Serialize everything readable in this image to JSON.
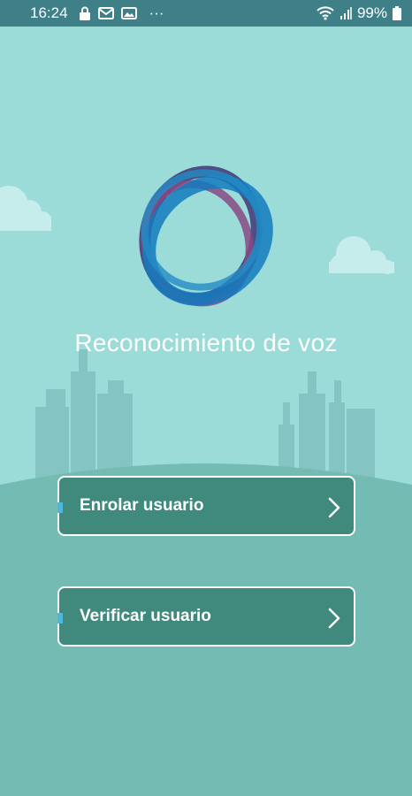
{
  "status_bar": {
    "time": "16:24",
    "notifications": [
      "lock-icon",
      "mail-icon",
      "gallery-icon"
    ],
    "overflow": "···",
    "battery": "99%",
    "icons": [
      "wifi-icon",
      "signal-icon",
      "battery-icon"
    ]
  },
  "app": {
    "title": "Reconocimiento de voz",
    "logo": "voice-recognition-logo"
  },
  "menu": {
    "enrol_label": "Enrolar usuario",
    "verify_label": "Verificar usuario"
  },
  "colors": {
    "background": "#9bdcd9",
    "status_bar": "#3f7f87",
    "button": "#3f8a7d",
    "ground": "#74bcb3",
    "logo_blue": "#1f8fe0",
    "logo_purple": "#6a3c8a",
    "logo_pink": "#e0559a"
  }
}
